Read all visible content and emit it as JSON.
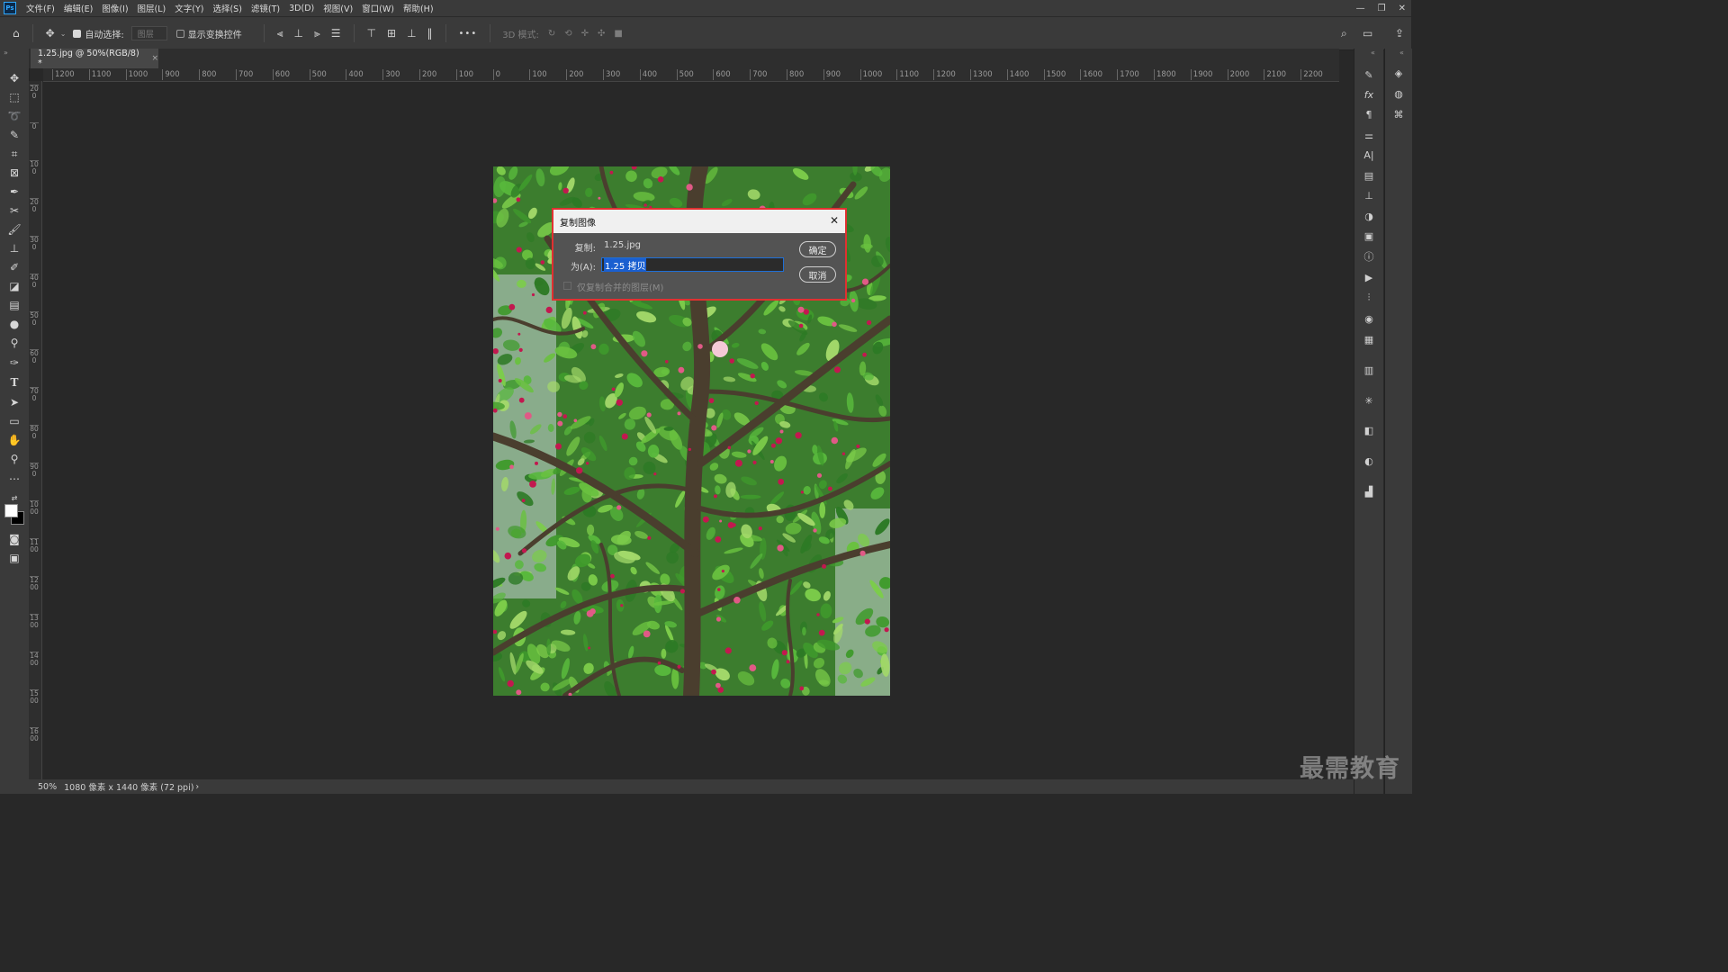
{
  "app": {
    "logo": "Ps"
  },
  "menu": [
    "文件(F)",
    "编辑(E)",
    "图像(I)",
    "图层(L)",
    "文字(Y)",
    "选择(S)",
    "滤镜(T)",
    "3D(D)",
    "视图(V)",
    "窗口(W)",
    "帮助(H)"
  ],
  "window_controls": {
    "minimize": "—",
    "restore": "❐",
    "close": "✕"
  },
  "options_bar": {
    "auto_select_label": "自动选择:",
    "auto_select_checked": true,
    "layer_select_value": "图层",
    "show_transform_label": "显示变换控件",
    "more_label": "•••",
    "mode_3d_label": "3D 模式:"
  },
  "document_tab": {
    "title": "1.25.jpg @ 50%(RGB/8) *",
    "close": "×"
  },
  "ruler_h": [
    "1200",
    "1100",
    "1000",
    "900",
    "800",
    "700",
    "600",
    "500",
    "400",
    "300",
    "200",
    "100",
    "0",
    "100",
    "200",
    "300",
    "400",
    "500",
    "600",
    "700",
    "800",
    "900",
    "1000",
    "1100",
    "1200",
    "1300",
    "1400",
    "1500",
    "1600",
    "1700",
    "1800",
    "1900",
    "2000",
    "2100",
    "2200"
  ],
  "ruler_v": [
    "200",
    "0",
    "100",
    "200",
    "300",
    "400",
    "500",
    "600",
    "700",
    "800",
    "900",
    "1000",
    "1100",
    "1200",
    "1300",
    "1400",
    "1500",
    "1600"
  ],
  "dialog": {
    "title": "复制图像",
    "close": "✕",
    "source_label": "复制:",
    "source_value": "1.25.jpg",
    "as_label": "为(A):",
    "as_value": "1.25 拷贝",
    "ok_label": "确定",
    "cancel_label": "取消",
    "merged_only_label": "仅复制合并的图层(M)"
  },
  "status": {
    "zoom": "50%",
    "info": "1080 像素 x 1440 像素 (72 ppi)",
    "arrow": "›"
  },
  "watermark": "最需教育",
  "colors": {
    "accent": "#31a8ff",
    "dialog_border": "#e03131",
    "selection": "#1a5fd0"
  }
}
